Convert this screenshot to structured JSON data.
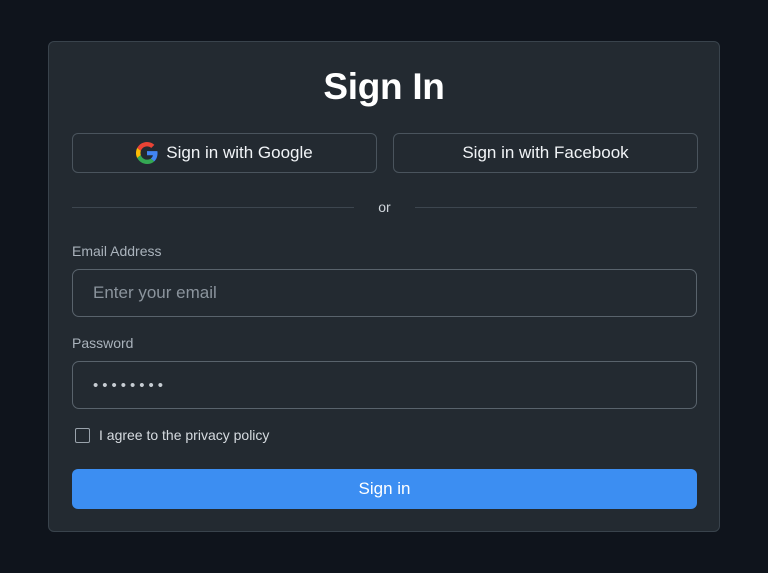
{
  "form": {
    "title": "Sign In",
    "google_label": "Sign in with Google",
    "facebook_label": "Sign in with Facebook",
    "divider_text": "or",
    "email_label": "Email Address",
    "email_placeholder": "Enter your email",
    "email_value": "",
    "password_label": "Password",
    "password_masked": "••••••••",
    "agree_label": "I agree to the privacy policy",
    "agree_checked": false,
    "submit_label": "Sign in"
  },
  "colors": {
    "background": "#0f141c",
    "card": "#232a31",
    "accent": "#3c8ef2"
  },
  "icons": {
    "google": "google-g-icon"
  }
}
